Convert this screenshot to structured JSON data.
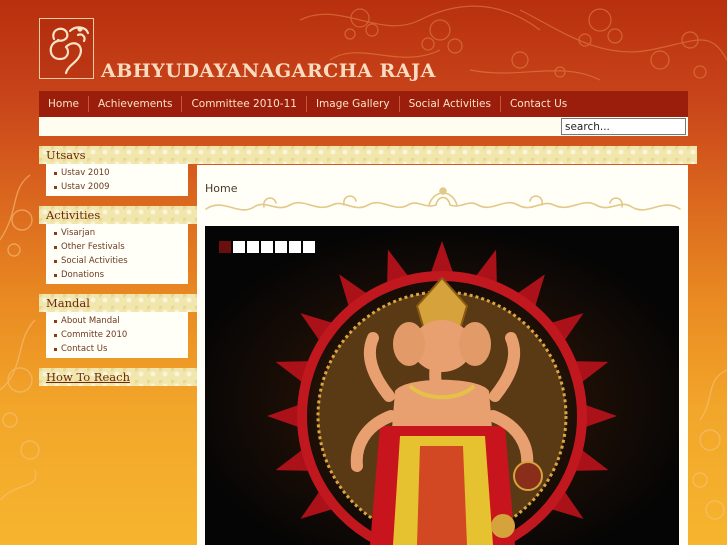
{
  "site": {
    "title": "ABHYUDAYANAGARCHA RAJA"
  },
  "nav": {
    "items": [
      {
        "label": "Home"
      },
      {
        "label": "Achievements"
      },
      {
        "label": "Committee 2010-11"
      },
      {
        "label": "Image Gallery"
      },
      {
        "label": "Social Activities"
      },
      {
        "label": "Contact Us"
      }
    ]
  },
  "search": {
    "value": "search..."
  },
  "sidebar": {
    "utsavs": {
      "heading": "Utsavs",
      "items": [
        "Ustav 2010",
        "Ustav 2009"
      ]
    },
    "activities": {
      "heading": "Activities",
      "items": [
        "Visarjan",
        "Other Festivals",
        "Social Activities",
        "Donations"
      ]
    },
    "mandal": {
      "heading": "Mandal",
      "items": [
        "About Mandal",
        "Committe 2010",
        "Contact Us"
      ]
    },
    "how_to_reach": "How To Reach"
  },
  "main": {
    "breadcrumb": "Home",
    "slideshow": {
      "slide_count": 7,
      "active_slide": 1
    }
  },
  "colors": {
    "nav_bg": "#9b1e0c",
    "accent_gold": "#f1e6ac",
    "active_dot": "#6b0e0e"
  }
}
